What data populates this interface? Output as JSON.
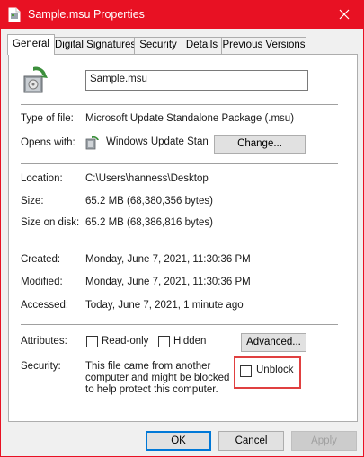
{
  "window": {
    "title": "Sample.msu Properties",
    "title_icon": "file-icon",
    "close_icon": "close-icon",
    "colors": {
      "titlebar": "#e81123",
      "focus": "#0078d7",
      "highlight": "#e04040"
    }
  },
  "tabs": [
    {
      "label": "General",
      "active": true
    },
    {
      "label": "Digital Signatures",
      "active": false
    },
    {
      "label": "Security",
      "active": false
    },
    {
      "label": "Details",
      "active": false
    },
    {
      "label": "Previous Versions",
      "active": false
    }
  ],
  "general": {
    "file_name": "Sample.msu",
    "type_label": "Type of file:",
    "type_value": "Microsoft Update Standalone Package (.msu)",
    "opens_label": "Opens with:",
    "opens_value": "Windows Update Standalone Installer",
    "opens_icon": "windows-update-icon",
    "change_button": "Change...",
    "location_label": "Location:",
    "location_value": "C:\\Users\\hanness\\Desktop",
    "size_label": "Size:",
    "size_value": "65.2 MB (68,380,356 bytes)",
    "size_on_disk_label": "Size on disk:",
    "size_on_disk_value": "65.2 MB (68,386,816 bytes)",
    "created_label": "Created:",
    "created_value": "Monday, June 7, 2021, 11:30:36 PM",
    "modified_label": "Modified:",
    "modified_value": "Monday, June 7, 2021, 11:30:36 PM",
    "accessed_label": "Accessed:",
    "accessed_value": "Today, June 7, 2021, 1 minute ago",
    "attributes_label": "Attributes:",
    "readonly_label": "Read-only",
    "readonly_checked": false,
    "hidden_label": "Hidden",
    "hidden_checked": false,
    "advanced_button": "Advanced...",
    "security_label": "Security:",
    "security_text": "This file came from another computer and might be blocked to help protect this computer.",
    "unblock_label": "Unblock",
    "unblock_checked": false
  },
  "footer": {
    "ok": "OK",
    "cancel": "Cancel",
    "apply": "Apply"
  }
}
